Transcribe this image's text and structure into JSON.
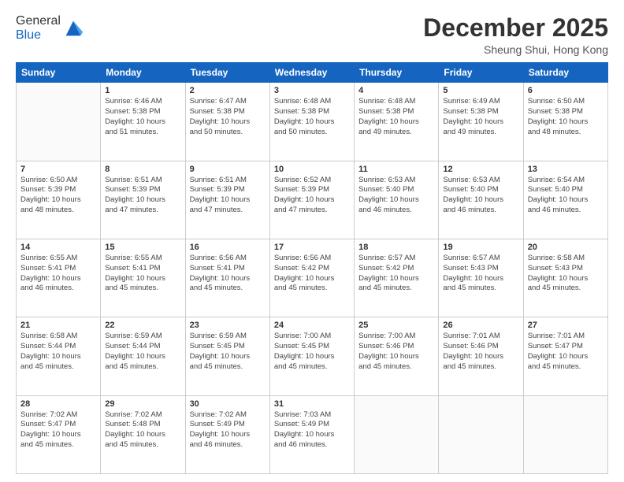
{
  "header": {
    "logo_general": "General",
    "logo_blue": "Blue",
    "month": "December 2025",
    "location": "Sheung Shui, Hong Kong"
  },
  "weekdays": [
    "Sunday",
    "Monday",
    "Tuesday",
    "Wednesday",
    "Thursday",
    "Friday",
    "Saturday"
  ],
  "weeks": [
    [
      {
        "day": "",
        "info": ""
      },
      {
        "day": "1",
        "info": "Sunrise: 6:46 AM\nSunset: 5:38 PM\nDaylight: 10 hours\nand 51 minutes."
      },
      {
        "day": "2",
        "info": "Sunrise: 6:47 AM\nSunset: 5:38 PM\nDaylight: 10 hours\nand 50 minutes."
      },
      {
        "day": "3",
        "info": "Sunrise: 6:48 AM\nSunset: 5:38 PM\nDaylight: 10 hours\nand 50 minutes."
      },
      {
        "day": "4",
        "info": "Sunrise: 6:48 AM\nSunset: 5:38 PM\nDaylight: 10 hours\nand 49 minutes."
      },
      {
        "day": "5",
        "info": "Sunrise: 6:49 AM\nSunset: 5:38 PM\nDaylight: 10 hours\nand 49 minutes."
      },
      {
        "day": "6",
        "info": "Sunrise: 6:50 AM\nSunset: 5:38 PM\nDaylight: 10 hours\nand 48 minutes."
      }
    ],
    [
      {
        "day": "7",
        "info": "Sunrise: 6:50 AM\nSunset: 5:39 PM\nDaylight: 10 hours\nand 48 minutes."
      },
      {
        "day": "8",
        "info": "Sunrise: 6:51 AM\nSunset: 5:39 PM\nDaylight: 10 hours\nand 47 minutes."
      },
      {
        "day": "9",
        "info": "Sunrise: 6:51 AM\nSunset: 5:39 PM\nDaylight: 10 hours\nand 47 minutes."
      },
      {
        "day": "10",
        "info": "Sunrise: 6:52 AM\nSunset: 5:39 PM\nDaylight: 10 hours\nand 47 minutes."
      },
      {
        "day": "11",
        "info": "Sunrise: 6:53 AM\nSunset: 5:40 PM\nDaylight: 10 hours\nand 46 minutes."
      },
      {
        "day": "12",
        "info": "Sunrise: 6:53 AM\nSunset: 5:40 PM\nDaylight: 10 hours\nand 46 minutes."
      },
      {
        "day": "13",
        "info": "Sunrise: 6:54 AM\nSunset: 5:40 PM\nDaylight: 10 hours\nand 46 minutes."
      }
    ],
    [
      {
        "day": "14",
        "info": "Sunrise: 6:55 AM\nSunset: 5:41 PM\nDaylight: 10 hours\nand 46 minutes."
      },
      {
        "day": "15",
        "info": "Sunrise: 6:55 AM\nSunset: 5:41 PM\nDaylight: 10 hours\nand 45 minutes."
      },
      {
        "day": "16",
        "info": "Sunrise: 6:56 AM\nSunset: 5:41 PM\nDaylight: 10 hours\nand 45 minutes."
      },
      {
        "day": "17",
        "info": "Sunrise: 6:56 AM\nSunset: 5:42 PM\nDaylight: 10 hours\nand 45 minutes."
      },
      {
        "day": "18",
        "info": "Sunrise: 6:57 AM\nSunset: 5:42 PM\nDaylight: 10 hours\nand 45 minutes."
      },
      {
        "day": "19",
        "info": "Sunrise: 6:57 AM\nSunset: 5:43 PM\nDaylight: 10 hours\nand 45 minutes."
      },
      {
        "day": "20",
        "info": "Sunrise: 6:58 AM\nSunset: 5:43 PM\nDaylight: 10 hours\nand 45 minutes."
      }
    ],
    [
      {
        "day": "21",
        "info": "Sunrise: 6:58 AM\nSunset: 5:44 PM\nDaylight: 10 hours\nand 45 minutes."
      },
      {
        "day": "22",
        "info": "Sunrise: 6:59 AM\nSunset: 5:44 PM\nDaylight: 10 hours\nand 45 minutes."
      },
      {
        "day": "23",
        "info": "Sunrise: 6:59 AM\nSunset: 5:45 PM\nDaylight: 10 hours\nand 45 minutes."
      },
      {
        "day": "24",
        "info": "Sunrise: 7:00 AM\nSunset: 5:45 PM\nDaylight: 10 hours\nand 45 minutes."
      },
      {
        "day": "25",
        "info": "Sunrise: 7:00 AM\nSunset: 5:46 PM\nDaylight: 10 hours\nand 45 minutes."
      },
      {
        "day": "26",
        "info": "Sunrise: 7:01 AM\nSunset: 5:46 PM\nDaylight: 10 hours\nand 45 minutes."
      },
      {
        "day": "27",
        "info": "Sunrise: 7:01 AM\nSunset: 5:47 PM\nDaylight: 10 hours\nand 45 minutes."
      }
    ],
    [
      {
        "day": "28",
        "info": "Sunrise: 7:02 AM\nSunset: 5:47 PM\nDaylight: 10 hours\nand 45 minutes."
      },
      {
        "day": "29",
        "info": "Sunrise: 7:02 AM\nSunset: 5:48 PM\nDaylight: 10 hours\nand 45 minutes."
      },
      {
        "day": "30",
        "info": "Sunrise: 7:02 AM\nSunset: 5:49 PM\nDaylight: 10 hours\nand 46 minutes."
      },
      {
        "day": "31",
        "info": "Sunrise: 7:03 AM\nSunset: 5:49 PM\nDaylight: 10 hours\nand 46 minutes."
      },
      {
        "day": "",
        "info": ""
      },
      {
        "day": "",
        "info": ""
      },
      {
        "day": "",
        "info": ""
      }
    ]
  ]
}
